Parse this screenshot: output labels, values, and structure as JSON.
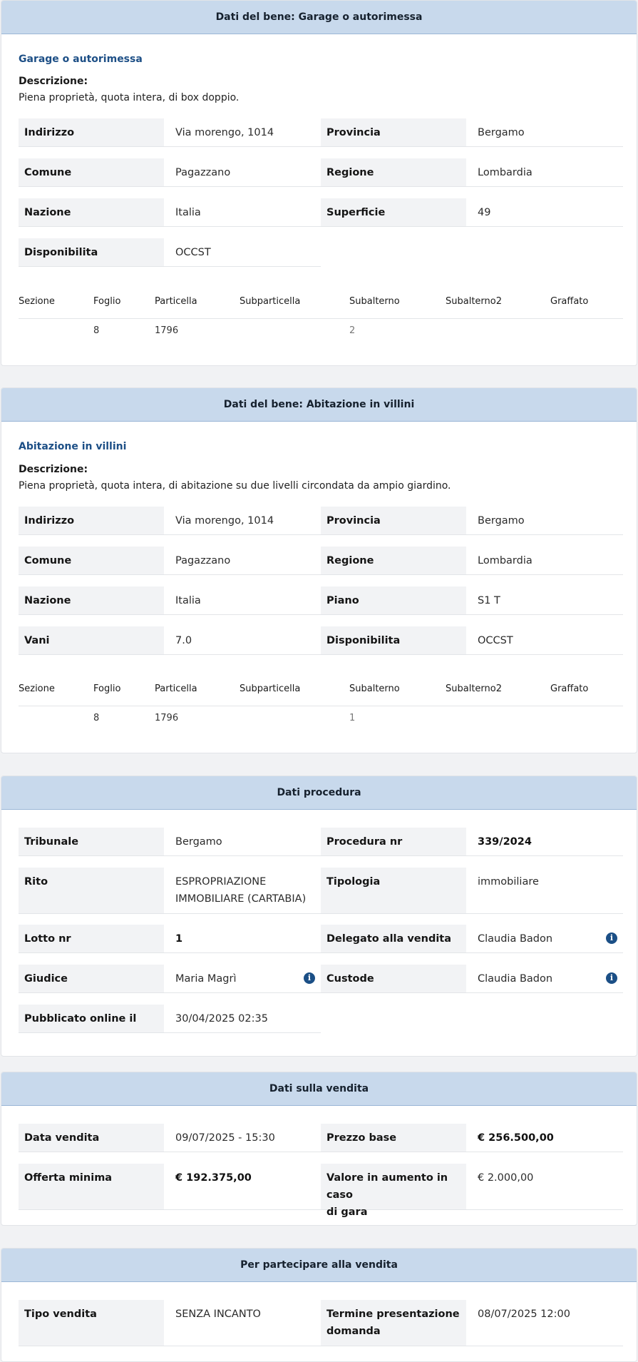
{
  "bene1": {
    "header": "Dati del bene: Garage o autorimessa",
    "subtitle": "Garage o autorimessa",
    "descrizione_label": "Descrizione:",
    "descrizione": "Piena proprietà, quota intera, di box doppio.",
    "rows": [
      {
        "k1": "Indirizzo",
        "v1": "Via morengo, 1014",
        "k2": "Provincia",
        "v2": "Bergamo"
      },
      {
        "k1": "Comune",
        "v1": "Pagazzano",
        "k2": "Regione",
        "v2": "Lombardia"
      },
      {
        "k1": "Nazione",
        "v1": "Italia",
        "k2": "Superficie",
        "v2": "49"
      },
      {
        "k1": "Disponibilita",
        "v1": "OCCST"
      }
    ],
    "catasto_headers": [
      "Sezione",
      "Foglio",
      "Particella",
      "Subparticella",
      "Subalterno",
      "Subalterno2",
      "Graffato"
    ],
    "catasto_row": {
      "foglio": "8",
      "particella": "1796",
      "subalterno": "2"
    }
  },
  "bene2": {
    "header": "Dati del bene: Abitazione in villini",
    "subtitle": "Abitazione in villini",
    "descrizione_label": "Descrizione:",
    "descrizione": "Piena proprietà, quota intera, di abitazione su due livelli circondata da ampio giardino.",
    "rows": [
      {
        "k1": "Indirizzo",
        "v1": "Via morengo, 1014",
        "k2": "Provincia",
        "v2": "Bergamo"
      },
      {
        "k1": "Comune",
        "v1": "Pagazzano",
        "k2": "Regione",
        "v2": "Lombardia"
      },
      {
        "k1": "Nazione",
        "v1": "Italia",
        "k2": "Piano",
        "v2": "S1 T"
      },
      {
        "k1": "Vani",
        "v1": "7.0",
        "k2": "Disponibilita",
        "v2": "OCCST"
      }
    ],
    "catasto_headers": [
      "Sezione",
      "Foglio",
      "Particella",
      "Subparticella",
      "Subalterno",
      "Subalterno2",
      "Graffato"
    ],
    "catasto_row": {
      "foglio": "8",
      "particella": "1796",
      "subalterno": "1"
    }
  },
  "procedura": {
    "header": "Dati procedura",
    "tribunale_label": "Tribunale",
    "tribunale": "Bergamo",
    "procedura_label": "Procedura nr",
    "procedura": "339/2024",
    "rito_label": "Rito",
    "rito_line1": "ESPROPRIAZIONE",
    "rito_line2": "IMMOBILIARE (CARTABIA)",
    "tipologia_label": "Tipologia",
    "tipologia": "immobiliare",
    "lotto_label": "Lotto nr",
    "lotto": "1",
    "delegato_label": "Delegato alla vendita",
    "delegato": "Claudia Badon",
    "giudice_label": "Giudice",
    "giudice": "Maria Magrì",
    "custode_label": "Custode",
    "custode": "Claudia Badon",
    "pubblicato_label": "Pubblicato online il",
    "pubblicato": "30/04/2025 02:35",
    "info_glyph": "i"
  },
  "vendita": {
    "header": "Dati sulla vendita",
    "data_label": "Data vendita",
    "data": "09/07/2025 - 15:30",
    "prezzo_label": "Prezzo base",
    "prezzo": "€ 256.500,00",
    "offerta_label": "Offerta minima",
    "offerta": "€ 192.375,00",
    "aumento_label_1": "Valore in aumento in caso",
    "aumento_label_2": "di gara",
    "aumento": "€ 2.000,00"
  },
  "partecipa": {
    "header": "Per partecipare alla vendita",
    "tipo_label": "Tipo vendita",
    "tipo": "SENZA INCANTO",
    "termine_label_1": "Termine presentazione",
    "termine_label_2": "domanda",
    "termine": "08/07/2025 12:00"
  },
  "colors": {
    "accent": "#1d4f86",
    "header_bg": "#c8d9ec",
    "key_bg": "#f2f3f5"
  }
}
